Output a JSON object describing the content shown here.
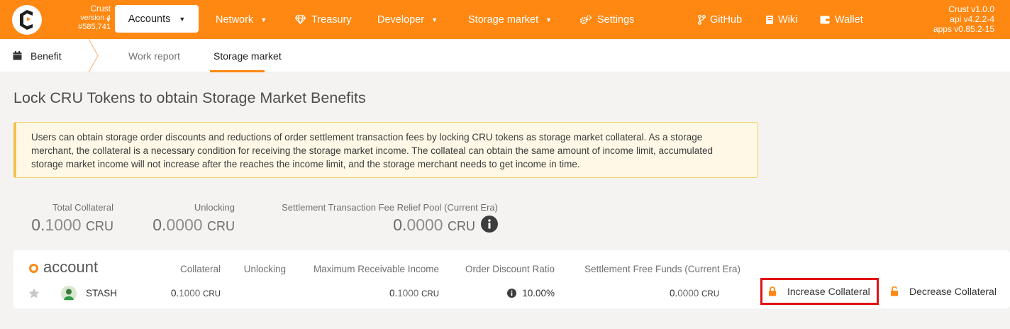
{
  "chain": {
    "name": "Crust",
    "version": "version 4",
    "block": "#585,741"
  },
  "nav": {
    "accounts": "Accounts",
    "network": "Network",
    "treasury": "Treasury",
    "developer": "Developer",
    "storage_market": "Storage market",
    "settings": "Settings",
    "github": "GitHub",
    "wiki": "Wiki",
    "wallet": "Wallet"
  },
  "versions": {
    "app": "Crust v1.0.0",
    "api": "api v4.2.2-4",
    "apps": "apps v0.85.2-15"
  },
  "tabs": {
    "root": "Benefit",
    "items": [
      "Work report",
      "Storage market"
    ],
    "active": "Storage market"
  },
  "page_title": "Lock CRU Tokens to obtain Storage Market Benefits",
  "notice": "Users can obtain storage order discounts and reductions of order settlement transaction fees by locking CRU tokens as storage market collateral. As a storage merchant, the collateral is a necessary condition for receiving the storage market income. The collateal can obtain the same amount of income limit, accumulated storage market income will not increase after the reaches the income limit, and the storage merchant needs to get income in time.",
  "summary": {
    "total_collateral": {
      "label": "Total Collateral",
      "int": "0.",
      "dec": "1000",
      "unit": "CRU"
    },
    "unlocking": {
      "label": "Unlocking",
      "int": "0.",
      "dec": "0000",
      "unit": "CRU"
    },
    "relief_pool": {
      "label": "Settlement Transaction Fee Relief Pool (Current Era)",
      "int": "0.",
      "dec": "0000",
      "unit": "CRU"
    }
  },
  "table": {
    "title": "account",
    "headers": {
      "collateral": "Collateral",
      "unlocking": "Unlocking",
      "max_income": "Maximum Receivable Income",
      "discount": "Order Discount Ratio",
      "free_funds": "Settlement Free Funds (Current Era)"
    },
    "row": {
      "name": "STASH",
      "collateral": {
        "int": "0.",
        "dec": "1000",
        "unit": "CRU"
      },
      "max_income": {
        "int": "0.",
        "dec": "1000",
        "unit": "CRU"
      },
      "discount": "10.00%",
      "free_funds": {
        "int": "0.",
        "dec": "0000",
        "unit": "CRU"
      }
    },
    "actions": {
      "increase": "Increase Collateral",
      "decrease": "Decrease Collateral"
    }
  },
  "colors": {
    "brand": "#ff8812",
    "highlight_border": "#e11212",
    "notice_bg": "#fff8e6"
  }
}
